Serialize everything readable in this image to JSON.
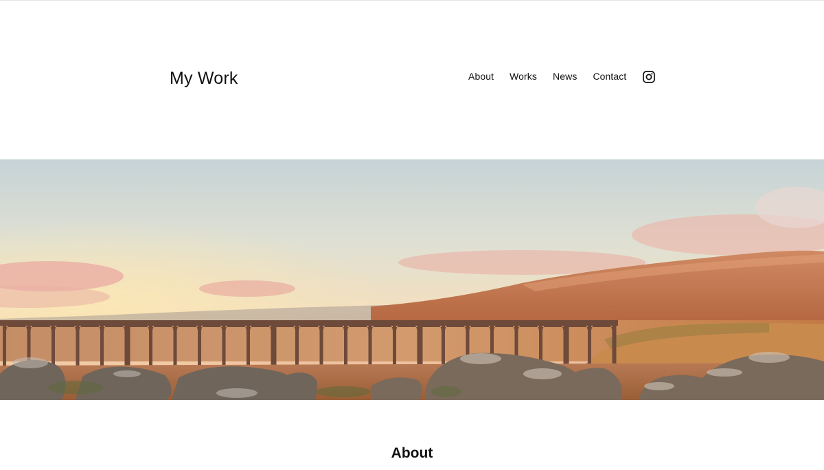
{
  "site": {
    "title": "My Work"
  },
  "nav": {
    "items": [
      {
        "label": "About"
      },
      {
        "label": "Works"
      },
      {
        "label": "News"
      },
      {
        "label": "Contact"
      }
    ],
    "social_icon": "instagram-icon"
  },
  "hero": {
    "image_kind": "landscape-photo",
    "colors": {
      "sky_top": "#c9d6d8",
      "sky_mid": "#efe0c8",
      "glow": "#f6d6a8",
      "cloud_pink": "#e9a6a0",
      "hill": "#c27a55",
      "bridge": "#6e4a3a",
      "ground": "#a8673d",
      "rocks": "#6d6258"
    }
  },
  "about": {
    "heading": "About"
  }
}
